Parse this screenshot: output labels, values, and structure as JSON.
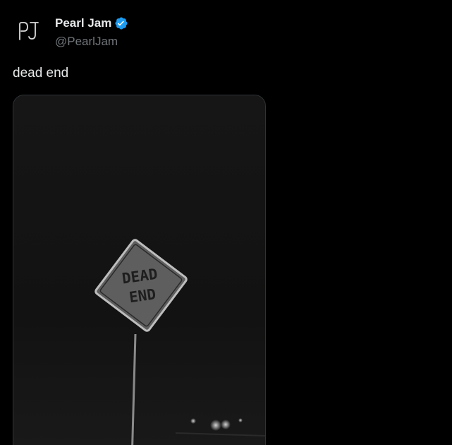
{
  "author": {
    "display_name": "Pearl Jam",
    "handle": "@PearlJam",
    "avatar_icon": "pj-monogram-logo",
    "verified": true,
    "verified_color": "#1d9bf0"
  },
  "tweet": {
    "text": "dead end"
  },
  "media": {
    "type": "photo",
    "sign_text_line1": "DEAD",
    "sign_text_line2": "END"
  },
  "colors": {
    "background": "#000000",
    "primary_text": "#e7e9ea",
    "secondary_text": "#71767b",
    "border": "#2f3336"
  }
}
